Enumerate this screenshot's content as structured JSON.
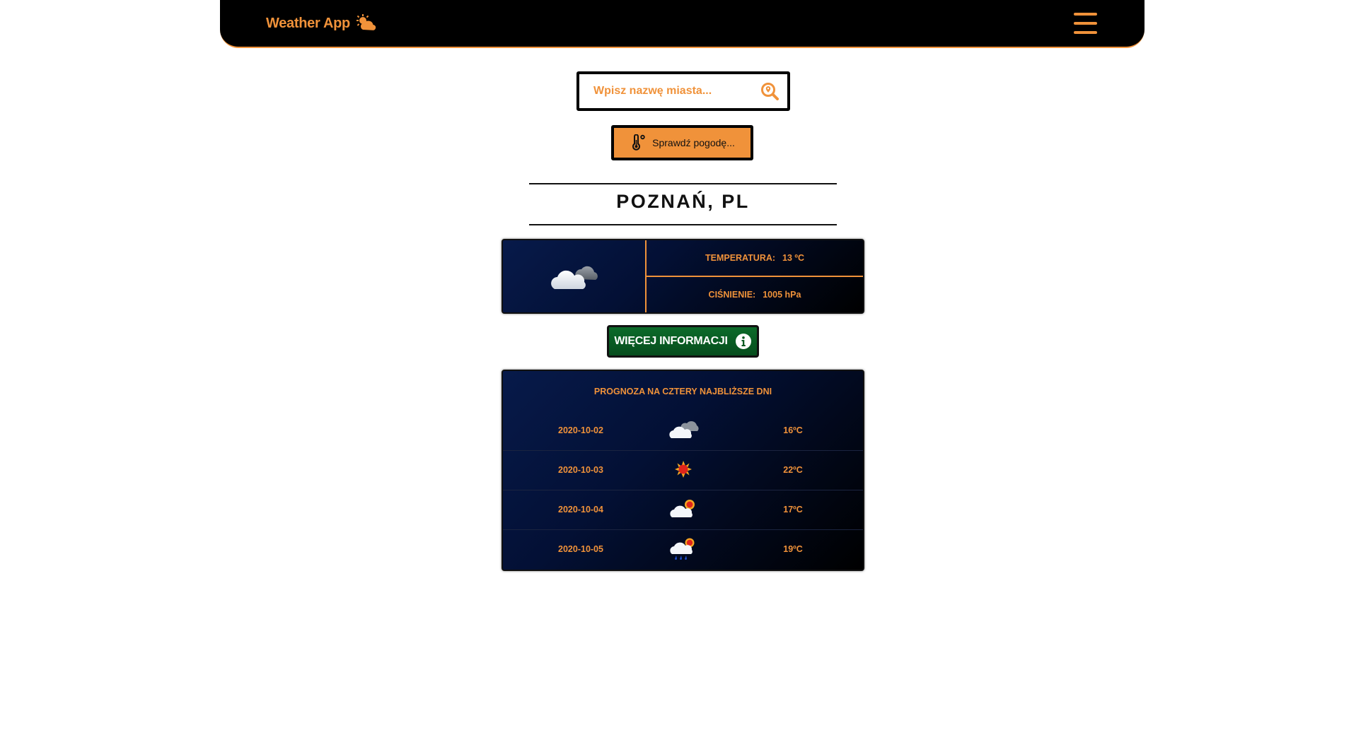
{
  "header": {
    "brand": "Weather App",
    "brand_icon": "sun-cloud-icon",
    "menu_icon": "hamburger-menu-icon"
  },
  "search": {
    "placeholder": "Wpisz nazwę miasta...",
    "value": "",
    "icon": "search-location-icon"
  },
  "check_button": {
    "label": "Sprawdź pogodę...",
    "icon": "thermometer-icon"
  },
  "city": "POZNAŃ, PL",
  "current": {
    "icon": "cloudy-icon",
    "temperature_label": "TEMPERATURA:",
    "temperature_value": "13 ºC",
    "pressure_label": "CIŚNIENIE:",
    "pressure_value": "1005 hPa"
  },
  "more_button": {
    "label": "WIĘCEJ INFORMACJI",
    "icon": "info-icon"
  },
  "forecast": {
    "title": "PROGNOZA NA CZTERY NAJBLIŻSZE DNI",
    "days": [
      {
        "date": "2020-10-02",
        "icon": "cloudy-icon",
        "temp": "16ºC"
      },
      {
        "date": "2020-10-03",
        "icon": "sun-icon",
        "temp": "22ºC"
      },
      {
        "date": "2020-10-04",
        "icon": "partly-cloudy-icon",
        "temp": "17ºC"
      },
      {
        "date": "2020-10-05",
        "icon": "rain-sun-icon",
        "temp": "19ºC"
      }
    ]
  },
  "colors": {
    "accent": "#f0923a",
    "navbar": "#000000",
    "panel": "#031035",
    "more_button": "#0c6b2a"
  }
}
